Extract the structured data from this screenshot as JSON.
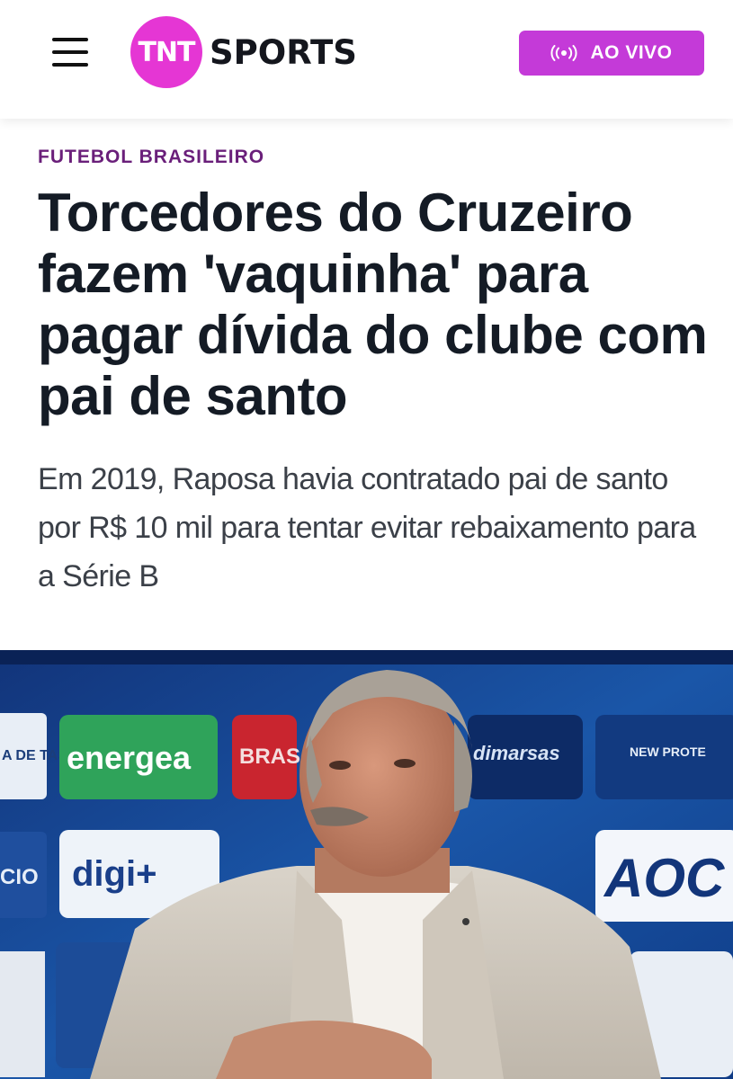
{
  "header": {
    "logo_mark": "TNT",
    "logo_text": "SPORTS",
    "live_label": "AO VIVO"
  },
  "article": {
    "category": "FUTEBOL BRASILEIRO",
    "headline": "Torcedores do Cruzeiro fazem 'vaquinha' para pagar dívida do clube com pai de santo",
    "subtitle": "Em 2019, Raposa havia contratado pai de santo por R$ 10 mil para tentar evitar rebaixamento para a Série B"
  },
  "photo": {
    "backdrop_logos": [
      "A DE TAS",
      "energea",
      "BRAS",
      "dimarsas",
      "NEW PROTE",
      "CIO",
      "digi+",
      "AOC"
    ]
  },
  "colors": {
    "brand_pink": "#e536d4",
    "live_button": "#c43ad8",
    "category": "#6a1f7a",
    "headline": "#141b25",
    "subtitle": "#3b4048"
  }
}
